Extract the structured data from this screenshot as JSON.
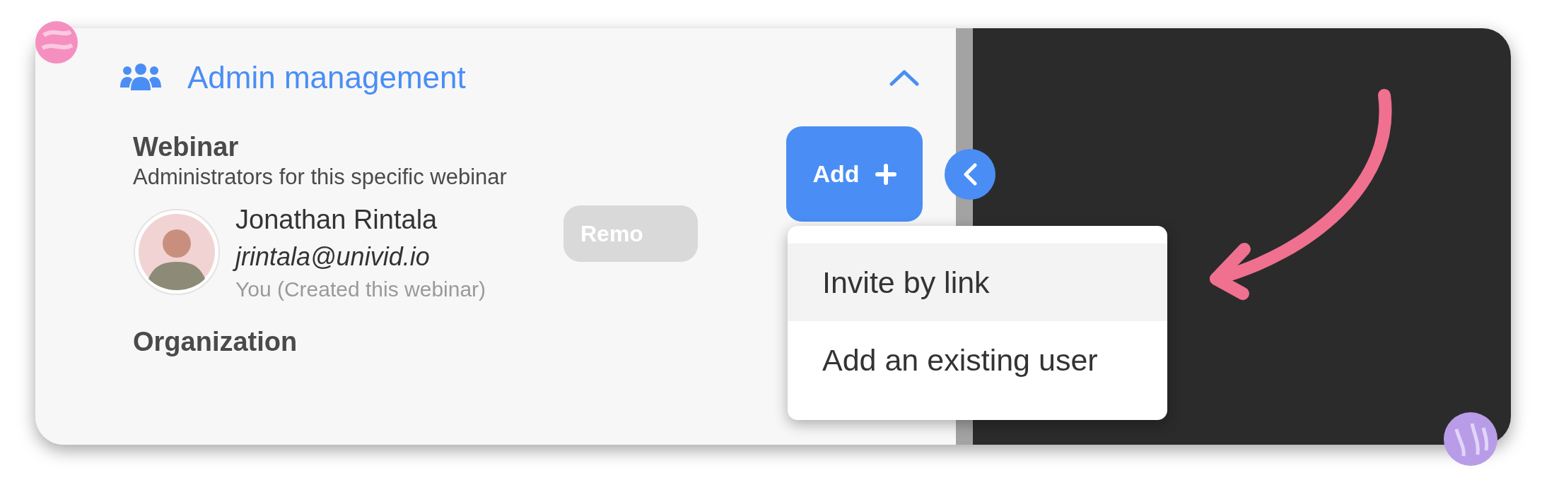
{
  "section": {
    "title": "Admin management",
    "expanded": true
  },
  "groups": [
    {
      "title": "Webinar",
      "description": "Administrators for this specific webinar",
      "admins": [
        {
          "name": "Jonathan Rintala",
          "email": "jrintala@univid.io",
          "note": "You (Created this webinar)",
          "action": "Remo"
        }
      ]
    },
    {
      "title": "Organization"
    }
  ],
  "add_button": {
    "label": "Add"
  },
  "menu": {
    "items": [
      {
        "label": "Invite by link",
        "selected": true
      },
      {
        "label": "Add an existing user",
        "selected": false
      }
    ]
  }
}
